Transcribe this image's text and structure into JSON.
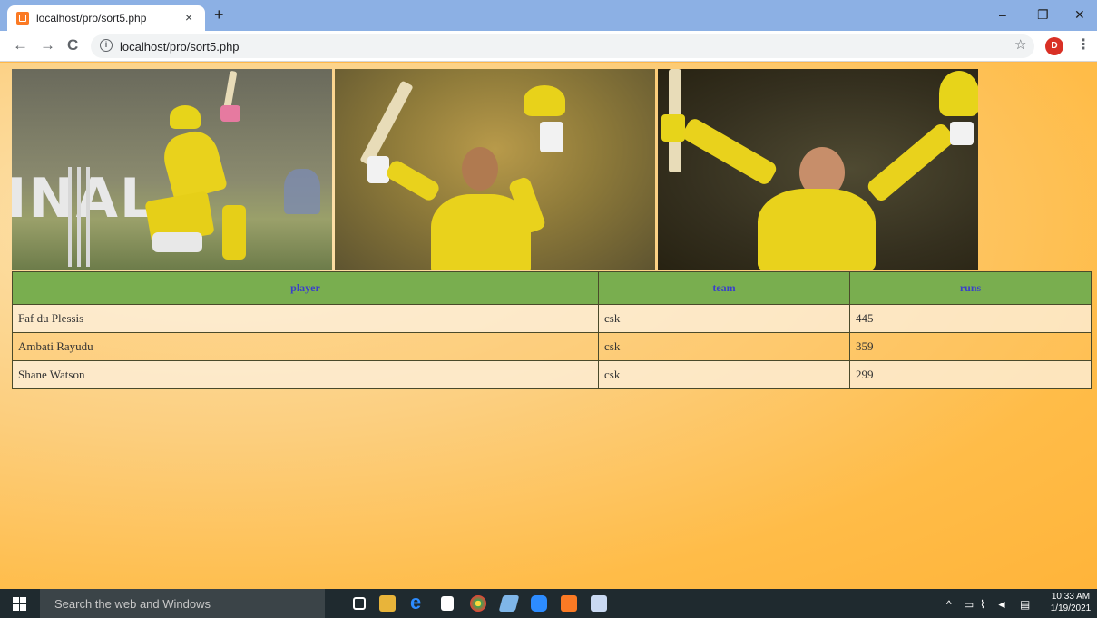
{
  "browser": {
    "tab_title": "localhost/pro/sort5.php",
    "tab_close": "×",
    "new_tab": "+",
    "url": "localhost/pro/sort5.php",
    "profile_initial": "D",
    "window_minimize": "–",
    "window_restore": "❐",
    "window_close": "✕"
  },
  "table": {
    "headers": [
      "player",
      "team",
      "runs"
    ],
    "rows": [
      [
        "Faf du Plessis",
        "csk",
        "445"
      ],
      [
        "Ambati Rayudu",
        "csk",
        "359"
      ],
      [
        "Shane Watson",
        "csk",
        "299"
      ]
    ]
  },
  "photos": {
    "photo1_banner": "INAL"
  },
  "taskbar": {
    "search_placeholder": "Search the web and Windows",
    "time": "10:33 AM",
    "date": "1/19/2021"
  },
  "colors": {
    "header_bg": "#79ae4f",
    "header_text": "#3a3fcb",
    "page_bg": "#ffb84a",
    "tab_strip": "#8cb0e4"
  }
}
